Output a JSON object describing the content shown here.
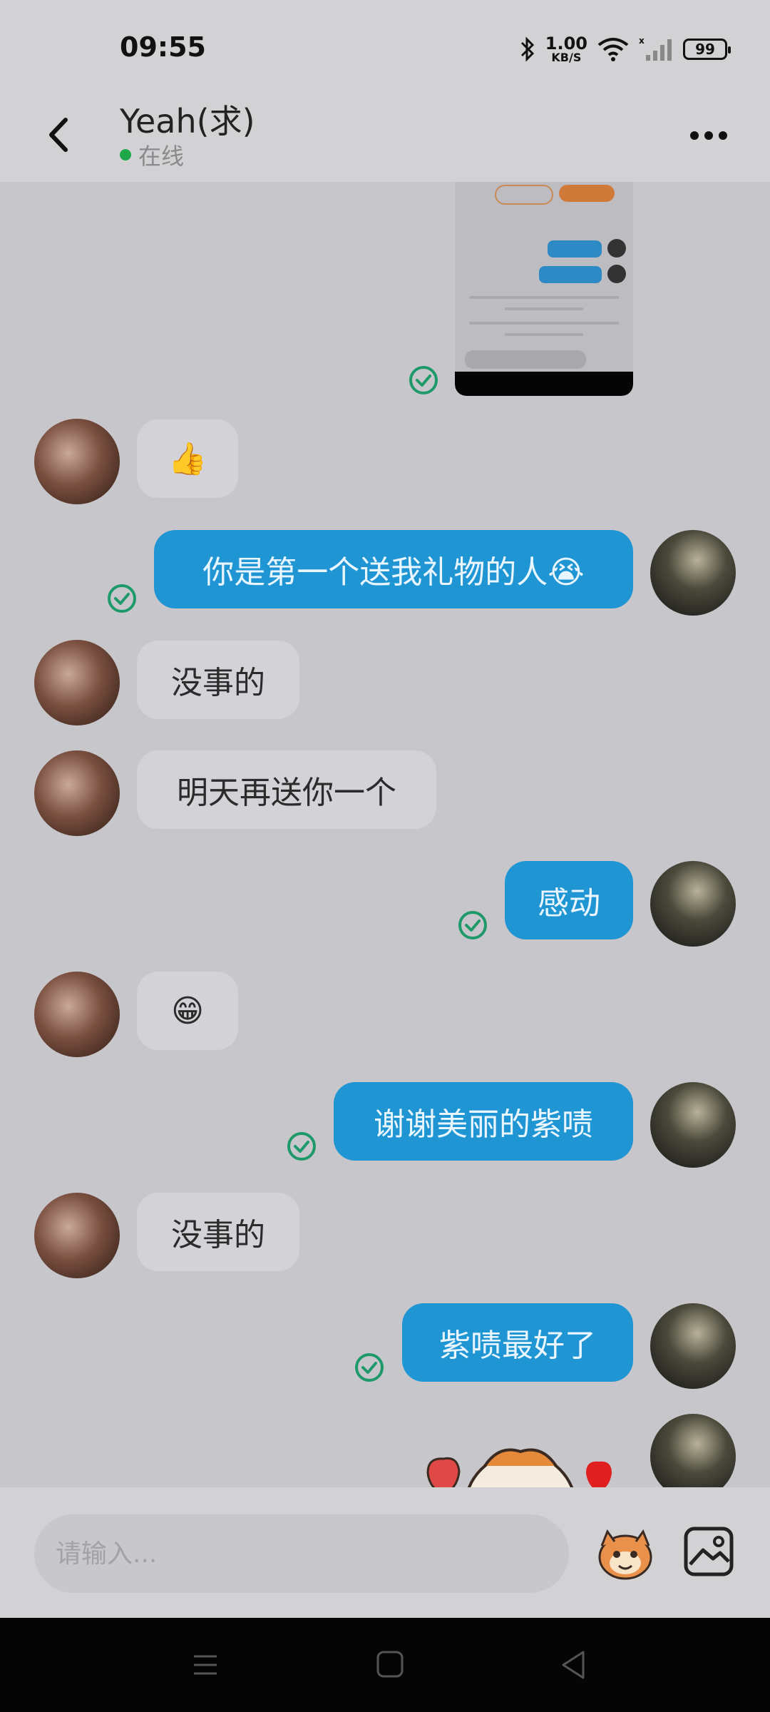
{
  "status_bar": {
    "time": "09:55",
    "net_speed": "1.00",
    "net_unit": "KB/S",
    "battery": "99"
  },
  "header": {
    "contact_name": "Yeah(求)",
    "online_status": "在线"
  },
  "messages": [
    {
      "side": "out",
      "type": "image",
      "text": ""
    },
    {
      "side": "in",
      "type": "text",
      "text": "👍"
    },
    {
      "side": "out",
      "type": "text",
      "text": "你是第一个送我礼物的人😭"
    },
    {
      "side": "in",
      "type": "text",
      "text": "没事的"
    },
    {
      "side": "in",
      "type": "text",
      "text": "明天再送你一个"
    },
    {
      "side": "out",
      "type": "text",
      "text": "感动"
    },
    {
      "side": "in",
      "type": "text",
      "text": "😁"
    },
    {
      "side": "out",
      "type": "text",
      "text": "谢谢美丽的紫啧"
    },
    {
      "side": "in",
      "type": "text",
      "text": "没事的"
    },
    {
      "side": "out",
      "type": "text",
      "text": "紫啧最好了"
    },
    {
      "side": "out",
      "type": "sticker",
      "text": ""
    }
  ],
  "input": {
    "placeholder": "请输入..."
  },
  "colors": {
    "outgoing_bubble": "#1f96d3",
    "incoming_bubble": "#d3d2d6",
    "online_dot": "#1ea84a",
    "read_check": "#1e9a6a"
  }
}
